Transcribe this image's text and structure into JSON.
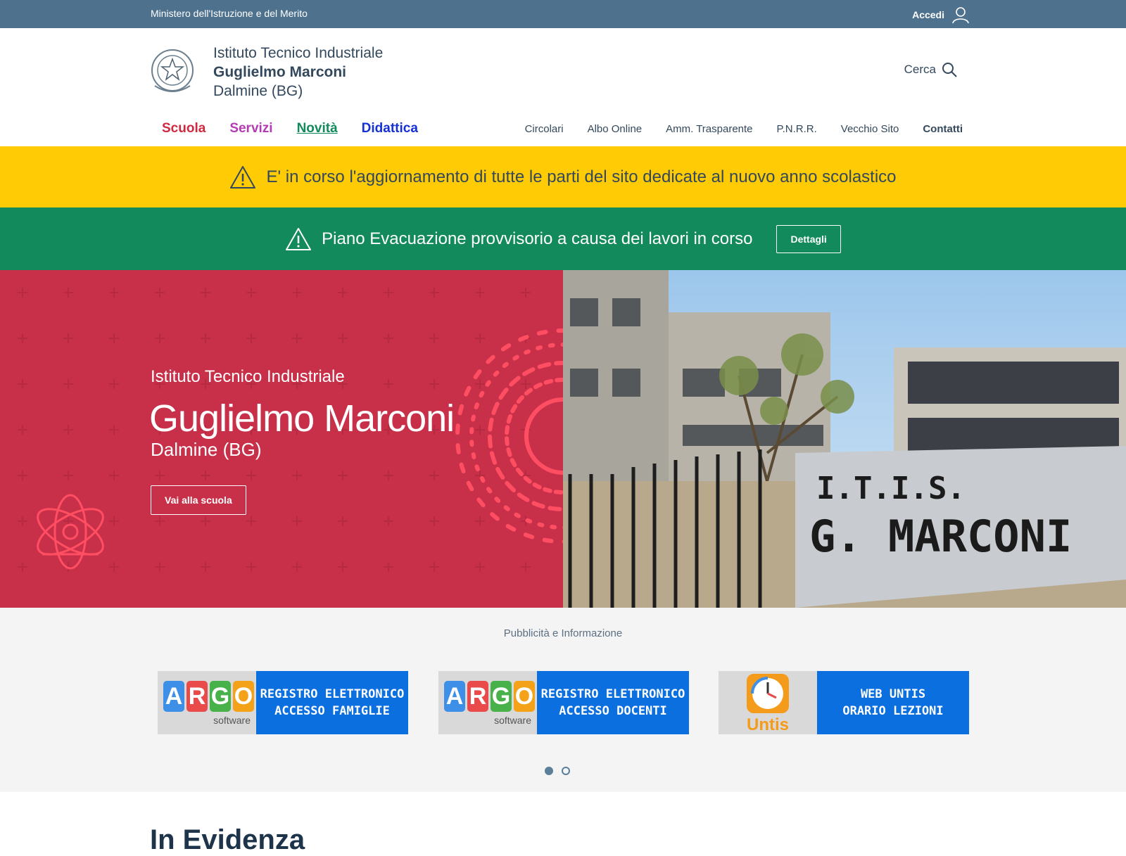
{
  "topbar": {
    "ministry": "Ministero dell'Istruzione e del Merito",
    "login_label": "Accedi"
  },
  "header": {
    "line1": "Istituto Tecnico Industriale",
    "line2": "Guglielmo Marconi",
    "line3": "Dalmine (BG)",
    "search_label": "Cerca"
  },
  "main_nav": [
    "Scuola",
    "Servizi",
    "Novità",
    "Didattica"
  ],
  "secondary_nav": [
    "Circolari",
    "Albo Online",
    "Amm. Trasparente",
    "P.N.R.R.",
    "Vecchio Sito",
    "Contatti"
  ],
  "alerts": {
    "yellow_text": "E' in corso l'aggiornamento di tutte le parti del sito dedicate al nuovo anno scolastico",
    "green_text": "Piano Evacuazione provvisorio a causa dei lavori in corso",
    "green_button": "Dettagli"
  },
  "hero": {
    "subtitle": "Istituto Tecnico Industriale",
    "title": "Guglielmo Marconi",
    "city": "Dalmine (BG)",
    "button": "Vai alla scuola",
    "sign_line1": "I.T.I.S.",
    "sign_line2": "G. MARCONI"
  },
  "banners": {
    "heading": "Pubblicità e Informazione",
    "items": [
      {
        "logo_word": "ARGO",
        "logo_sub": "software",
        "line1": "REGISTRO ELETTRONICO",
        "line2": "ACCESSO FAMIGLIE"
      },
      {
        "logo_word": "ARGO",
        "logo_sub": "software",
        "line1": "REGISTRO ELETTRONICO",
        "line2": "ACCESSO DOCENTI"
      },
      {
        "logo_word": "Untis",
        "line1": "WEB UNTIS",
        "line2": "ORARIO LEZIONI"
      }
    ],
    "active_page": 1,
    "page_count": 2
  },
  "section_title": "In Evidenza",
  "colors": {
    "topbar": "#4e728e",
    "alert_yellow": "#ffcb05",
    "alert_green": "#138a5b",
    "hero_red": "#c8304a",
    "banner_blue": "#0b6fe0"
  }
}
